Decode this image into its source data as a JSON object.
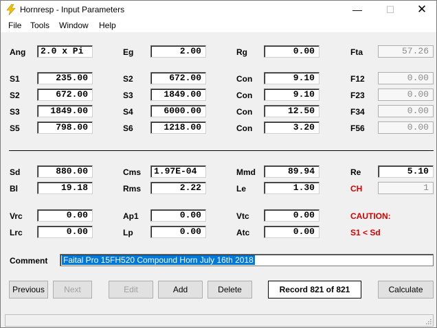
{
  "window": {
    "title": "Hornresp - Input Parameters",
    "min_symbol": "—",
    "max_symbol": "☐",
    "close_symbol": "✕"
  },
  "menu": [
    "File",
    "Tools",
    "Window",
    "Help"
  ],
  "params": {
    "ang": {
      "label": "Ang",
      "value": "2.0 x Pi"
    },
    "eg": {
      "label": "Eg",
      "value": "2.00"
    },
    "rg": {
      "label": "Rg",
      "value": "0.00"
    },
    "fta": {
      "label": "Fta",
      "value": "57.26"
    },
    "s1": {
      "label": "S1",
      "value": "235.00"
    },
    "s2a": {
      "label": "S2",
      "value": "672.00"
    },
    "con1": {
      "label": "Con",
      "value": "9.10"
    },
    "f12": {
      "label": "F12",
      "value": "0.00"
    },
    "s2b": {
      "label": "S2",
      "value": "672.00"
    },
    "s3a": {
      "label": "S3",
      "value": "1849.00"
    },
    "con2": {
      "label": "Con",
      "value": "9.10"
    },
    "f23": {
      "label": "F23",
      "value": "0.00"
    },
    "s3b": {
      "label": "S3",
      "value": "1849.00"
    },
    "s4": {
      "label": "S4",
      "value": "6000.00"
    },
    "con3": {
      "label": "Con",
      "value": "12.50"
    },
    "f34": {
      "label": "F34",
      "value": "0.00"
    },
    "s5": {
      "label": "S5",
      "value": "798.00"
    },
    "s6": {
      "label": "S6",
      "value": "1218.00"
    },
    "con4": {
      "label": "Con",
      "value": "3.20"
    },
    "f56": {
      "label": "F56",
      "value": "0.00"
    },
    "sd": {
      "label": "Sd",
      "value": "880.00"
    },
    "cms": {
      "label": "Cms",
      "value": "1.97E-04"
    },
    "mmd": {
      "label": "Mmd",
      "value": "89.94"
    },
    "re": {
      "label": "Re",
      "value": "5.10"
    },
    "bl": {
      "label": "Bl",
      "value": "19.18"
    },
    "rms": {
      "label": "Rms",
      "value": "2.22"
    },
    "le": {
      "label": "Le",
      "value": "1.30"
    },
    "ch": {
      "label": "CH",
      "value": "1"
    },
    "vrc": {
      "label": "Vrc",
      "value": "0.00"
    },
    "ap1": {
      "label": "Ap1",
      "value": "0.00"
    },
    "vtc": {
      "label": "Vtc",
      "value": "0.00"
    },
    "lrc": {
      "label": "Lrc",
      "value": "0.00"
    },
    "lp": {
      "label": "Lp",
      "value": "0.00"
    },
    "atc": {
      "label": "Atc",
      "value": "0.00"
    }
  },
  "caution": {
    "title": "CAUTION:",
    "message": "S1 < Sd"
  },
  "comment": {
    "label": "Comment",
    "value": "Faital Pro 15FH520 Compound Horn  July 16th 2018"
  },
  "buttons": {
    "previous": "Previous",
    "next": "Next",
    "edit": "Edit",
    "add": "Add",
    "delete": "Delete",
    "calculate": "Calculate"
  },
  "record": "Record 821 of 821",
  "colors": {
    "accent": "#0078d7",
    "warning": "#d40000",
    "title_icon": "#f2c200"
  }
}
